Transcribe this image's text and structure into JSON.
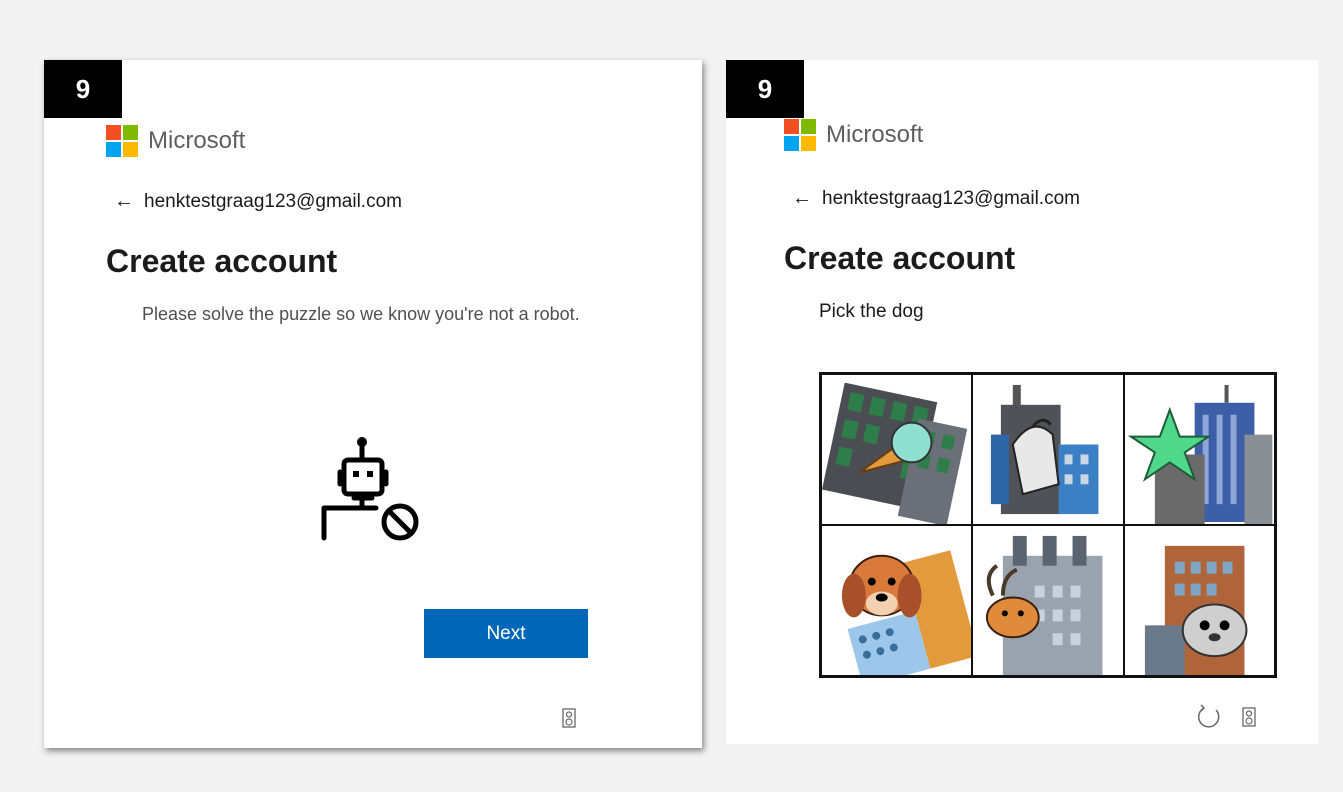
{
  "left_panel": {
    "step_number": "9",
    "brand": "Microsoft",
    "back_email": "henktestgraag123@gmail.com",
    "title": "Create account",
    "description": "Please solve the puzzle so we know you're not a robot.",
    "next_label": "Next",
    "icons": [
      "back-arrow-icon",
      "robot-blocked-icon",
      "audio-icon"
    ]
  },
  "right_panel": {
    "step_number": "9",
    "brand": "Microsoft",
    "back_email": "henktestgraag123@gmail.com",
    "title": "Create account",
    "prompt": "Pick the dog",
    "tiles": [
      {
        "subject": "ice-cream"
      },
      {
        "subject": "goat"
      },
      {
        "subject": "starfish"
      },
      {
        "subject": "dog"
      },
      {
        "subject": "deer"
      },
      {
        "subject": "seal"
      }
    ],
    "icons": [
      "refresh-icon",
      "audio-icon"
    ]
  },
  "colors": {
    "accent": "#0067b8",
    "ms_red": "#f25022",
    "ms_green": "#7fba00",
    "ms_blue": "#00a4ef",
    "ms_yellow": "#ffb900"
  }
}
